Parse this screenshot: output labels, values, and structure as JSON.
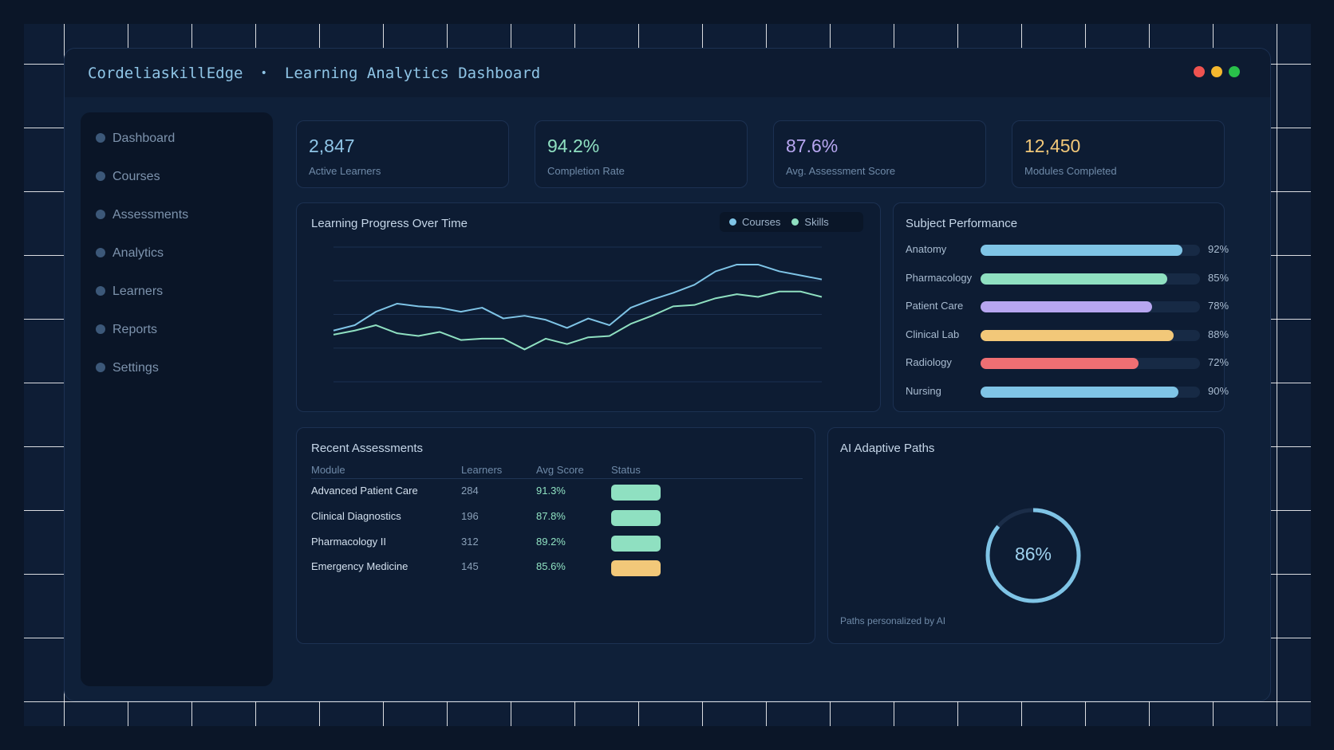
{
  "window": {
    "app_name": "CordeliaskillEdge",
    "separator": "•",
    "title": "Learning Analytics Dashboard",
    "traffic_colors": [
      "#ef5350",
      "#f5b82e",
      "#29c14a"
    ]
  },
  "sidebar": {
    "items": [
      {
        "label": "Dashboard",
        "active": false
      },
      {
        "label": "Courses",
        "active": false
      },
      {
        "label": "Assessments",
        "active": false
      },
      {
        "label": "Analytics",
        "active": true
      },
      {
        "label": "Learners",
        "active": false
      },
      {
        "label": "Reports",
        "active": false
      },
      {
        "label": "Settings",
        "active": false
      }
    ]
  },
  "stats": [
    {
      "value": "2,847",
      "label": "Active Learners",
      "color": "#8fc5e6"
    },
    {
      "value": "94.2%",
      "label": "Completion Rate",
      "color": "#8fe0c1"
    },
    {
      "value": "87.6%",
      "label": "Avg. Assessment Score",
      "color": "#b7a6f0"
    },
    {
      "value": "12,450",
      "label": "Modules Completed",
      "color": "#f2c879"
    }
  ],
  "progress_chart": {
    "title": "Learning Progress Over Time",
    "chart_data": {
      "type": "line",
      "x": [
        1,
        2,
        3,
        4,
        5,
        6,
        7,
        8,
        9,
        10,
        11,
        12,
        13,
        14,
        15,
        16,
        17,
        18,
        19,
        20,
        21,
        22,
        23,
        24
      ],
      "ylim": [
        0,
        100
      ],
      "grid": true,
      "legend_position": "top-right",
      "series": [
        {
          "name": "Courses",
          "color": "#7fc4e6",
          "values": [
            38,
            42,
            52,
            58,
            56,
            55,
            52,
            55,
            47,
            49,
            46,
            40,
            47,
            42,
            55,
            61,
            66,
            72,
            82,
            87,
            87,
            82,
            79,
            76
          ]
        },
        {
          "name": "Skills",
          "color": "#8fe0c1",
          "values": [
            35,
            38,
            42,
            36,
            34,
            37,
            31,
            32,
            32,
            24,
            32,
            28,
            33,
            34,
            43,
            49,
            56,
            57,
            62,
            65,
            63,
            67,
            67,
            63
          ]
        }
      ]
    }
  },
  "subject_performance": {
    "title": "Subject Performance",
    "chart_data": {
      "type": "bar",
      "categories": [
        "Anatomy",
        "Pharmacology",
        "Patient Care",
        "Clinical Lab",
        "Radiology",
        "Nursing"
      ],
      "values": [
        92,
        85,
        78,
        88,
        72,
        90
      ],
      "labels": [
        "92%",
        "85%",
        "78%",
        "88%",
        "72%",
        "90%"
      ],
      "colors": [
        "#7fc4e6",
        "#8fe0c1",
        "#b7a6f0",
        "#f2c879",
        "#ef6f73",
        "#7fc4e6"
      ]
    }
  },
  "assessments": {
    "title": "Recent Assessments",
    "columns": [
      "Module",
      "Learners",
      "Avg Score",
      "Status"
    ],
    "rows": [
      {
        "module": "Advanced Patient Care",
        "learners": "284",
        "score": "91.3%",
        "status_color": "#8fe0c1"
      },
      {
        "module": "Clinical Diagnostics",
        "learners": "196",
        "score": "87.8%",
        "status_color": "#8fe0c1"
      },
      {
        "module": "Pharmacology II",
        "learners": "312",
        "score": "89.2%",
        "status_color": "#8fe0c1"
      },
      {
        "module": "Emergency Medicine",
        "learners": "145",
        "score": "85.6%",
        "status_color": "#f2c879"
      }
    ]
  },
  "adaptive": {
    "title": "AI Adaptive Paths",
    "percent_label": "86%",
    "percent_value": 86,
    "caption": "Paths personalized by AI",
    "ring_color": "#7fc4e6"
  },
  "colors": {
    "accent": "#8fd3f0",
    "panel": "#0d1c33",
    "text_muted": "#6f8aa8"
  }
}
